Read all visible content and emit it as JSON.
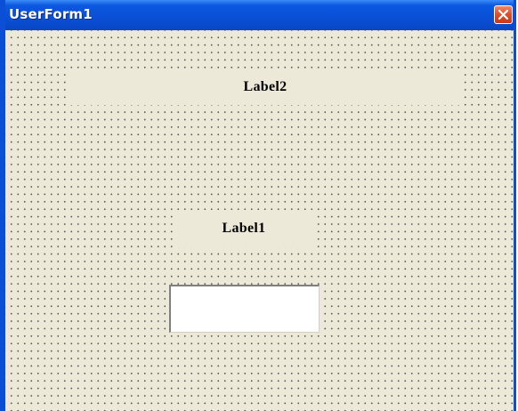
{
  "window": {
    "title": "UserForm1"
  },
  "form": {
    "label2": "Label2",
    "label1": "Label1",
    "textbox": {
      "value": "",
      "placeholder": ""
    }
  },
  "icons": {
    "close": "close-icon"
  },
  "colors": {
    "titlebar": "#0a4fd6",
    "close_button": "#e0502c",
    "client_background": "#ece9d8",
    "textbox_background": "#ffffff"
  }
}
